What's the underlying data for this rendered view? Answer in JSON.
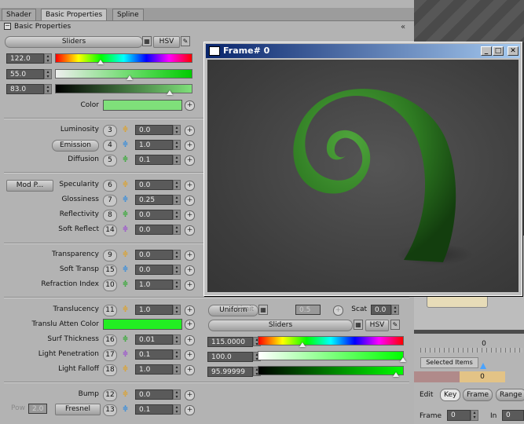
{
  "tabs": [
    "Shader",
    "Basic Properties",
    "Spline"
  ],
  "section_title": "Basic Properties",
  "color_mode": {
    "mode_label": "Sliders",
    "hsv_label": "HSV"
  },
  "hsv_values": [
    "122.0",
    "55.0",
    "83.0"
  ],
  "color_label": "Color",
  "color_hex": "#7fe07a",
  "props_group1": [
    {
      "label": "Luminosity",
      "num": "3",
      "value": "0.0"
    },
    {
      "label": "Emission",
      "num": "4",
      "value": "1.0"
    },
    {
      "label": "Diffusion",
      "num": "5",
      "value": "0.1"
    }
  ],
  "props_group2": [
    {
      "label": "Specularity",
      "num": "6",
      "value": "0.0"
    },
    {
      "label": "Glossiness",
      "num": "7",
      "value": "0.25"
    },
    {
      "label": "Reflectivity",
      "num": "8",
      "value": "0.0"
    },
    {
      "label": "Soft Reflect",
      "num": "14",
      "value": "0.0"
    }
  ],
  "mod_button": "Mod P...",
  "props_group3": [
    {
      "label": "Transparency",
      "num": "9",
      "value": "0.0"
    },
    {
      "label": "Soft Transp",
      "num": "15",
      "value": "0.0"
    },
    {
      "label": "Refraction Index",
      "num": "10",
      "value": "1.0"
    }
  ],
  "props_group4": [
    {
      "label": "Translucency",
      "num": "11",
      "value": "1.0"
    },
    {
      "label": "Translu Atten Color",
      "num": "",
      "value": ""
    },
    {
      "label": "Surf Thickness",
      "num": "16",
      "value": "0.01"
    },
    {
      "label": "Light Penetration",
      "num": "17",
      "value": "0.1"
    },
    {
      "label": "Light Falloff",
      "num": "18",
      "value": "1.0"
    }
  ],
  "atten_color_hex": "#22ee22",
  "props_group5": [
    {
      "label": "Bump",
      "num": "12",
      "value": "0.0"
    },
    {
      "label": "Fresnel",
      "num": "13",
      "value": "0.1"
    }
  ],
  "pow": {
    "label": "Pow",
    "value": "2.0"
  },
  "translucency_panel": {
    "uniform_label": "Uniform",
    "limit_label": "Limit",
    "limit_value": "0.5",
    "scat_label": "Scat",
    "scat_value": "0.0",
    "mode_label": "Sliders",
    "hsv_label": "HSV",
    "values": [
      "115.0000",
      "100.0",
      "95.99999"
    ]
  },
  "frame_window": {
    "title": "Frame# 0"
  },
  "timeline": {
    "zero_top": "0",
    "selected_items": "Selected Items",
    "key_value": "0",
    "edit_label": "Edit",
    "tabs": [
      "Key",
      "Frame",
      "Range"
    ],
    "frame_label": "Frame",
    "frame_value": "0",
    "in_label": "In",
    "in_value": "0"
  }
}
